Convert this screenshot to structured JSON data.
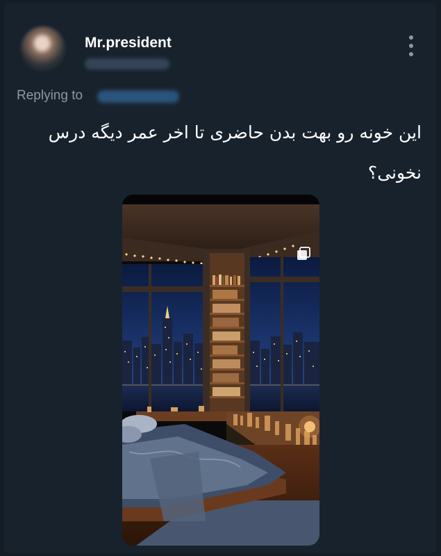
{
  "author": {
    "display_name": "Mr.president"
  },
  "reply": {
    "prefix": "Replying to"
  },
  "tweet": {
    "text": "این خونه رو بهت بدن حاضری تا اخر عمر دیگه درس نخونی؟"
  },
  "icons": {
    "more": "more-vertical-icon",
    "gallery": "multiple-images-icon"
  },
  "colors": {
    "background": "#18222d",
    "secondary_text": "#8b98a5",
    "primary_text": "#ffffff"
  }
}
